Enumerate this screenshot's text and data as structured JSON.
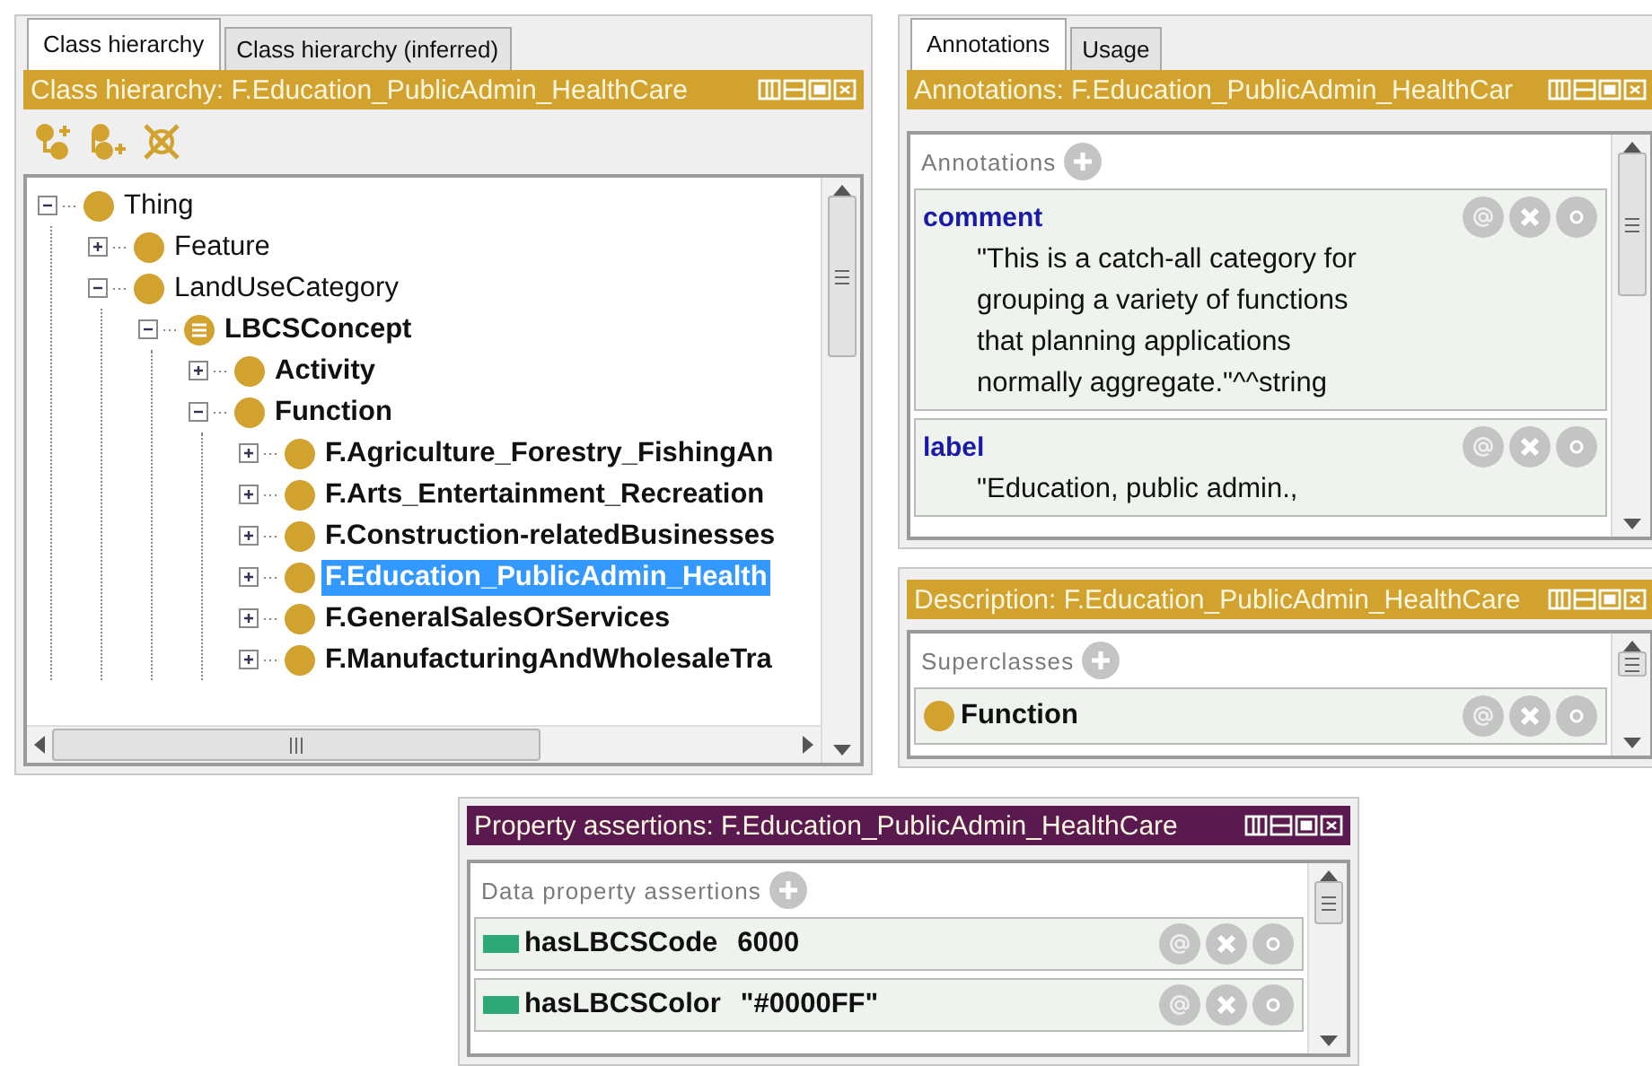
{
  "class_hierarchy": {
    "tabs": [
      {
        "label": "Class hierarchy",
        "selected": true
      },
      {
        "label": "Class hierarchy (inferred)",
        "selected": false
      }
    ],
    "title": "Class hierarchy: F.Education_PublicAdmin_HealthCare",
    "tree": [
      {
        "label": "Thing",
        "kind": "class",
        "bold": false,
        "expanded": true,
        "selected": false,
        "children": [
          {
            "label": "Feature",
            "kind": "class",
            "bold": false,
            "expanded": false,
            "selected": false
          },
          {
            "label": "LandUseCategory",
            "kind": "class",
            "bold": false,
            "expanded": true,
            "selected": false,
            "children": [
              {
                "label": "LBCSConcept",
                "kind": "defined",
                "bold": true,
                "expanded": true,
                "selected": false,
                "children": [
                  {
                    "label": "Activity",
                    "kind": "class",
                    "bold": true,
                    "expanded": false,
                    "selected": false
                  },
                  {
                    "label": "Function",
                    "kind": "class",
                    "bold": true,
                    "expanded": true,
                    "selected": false,
                    "children": [
                      {
                        "label": "F.Agriculture_Forestry_FishingAn",
                        "kind": "class",
                        "bold": true,
                        "expanded": false,
                        "selected": false
                      },
                      {
                        "label": "F.Arts_Entertainment_Recreation",
                        "kind": "class",
                        "bold": true,
                        "expanded": false,
                        "selected": false
                      },
                      {
                        "label": "F.Construction-relatedBusinesses",
                        "kind": "class",
                        "bold": true,
                        "expanded": false,
                        "selected": false
                      },
                      {
                        "label": "F.Education_PublicAdmin_Health",
                        "kind": "class",
                        "bold": true,
                        "expanded": false,
                        "selected": true
                      },
                      {
                        "label": "F.GeneralSalesOrServices",
                        "kind": "class",
                        "bold": true,
                        "expanded": false,
                        "selected": false
                      },
                      {
                        "label": "F.ManufacturingAndWholesaleTra",
                        "kind": "class",
                        "bold": true,
                        "expanded": false,
                        "selected": false
                      }
                    ]
                  }
                ]
              }
            ]
          }
        ]
      }
    ]
  },
  "annotations_view": {
    "tabs": [
      {
        "label": "Annotations",
        "selected": true
      },
      {
        "label": "Usage",
        "selected": false
      }
    ],
    "title": "Annotations: F.Education_PublicAdmin_HealthCar",
    "section": "Annotations",
    "items": [
      {
        "property": "comment",
        "lines": [
          "\"This is a catch-all category for",
          "grouping a variety of functions",
          "that planning applications",
          "normally aggregate.\"^^string"
        ]
      },
      {
        "property": "label",
        "lines": [
          "\"Education, public admin.,"
        ]
      }
    ]
  },
  "description_view": {
    "title": "Description: F.Education_PublicAdmin_HealthCare",
    "section": "Superclasses",
    "items": [
      {
        "label": "Function"
      }
    ]
  },
  "property_assertions": {
    "title": "Property assertions: F.Education_PublicAdmin_HealthCare",
    "section": "Data property assertions",
    "items": [
      {
        "property": "hasLBCSCode",
        "value": "6000"
      },
      {
        "property": "hasLBCSColor",
        "value": "\"#0000FF\""
      }
    ]
  }
}
